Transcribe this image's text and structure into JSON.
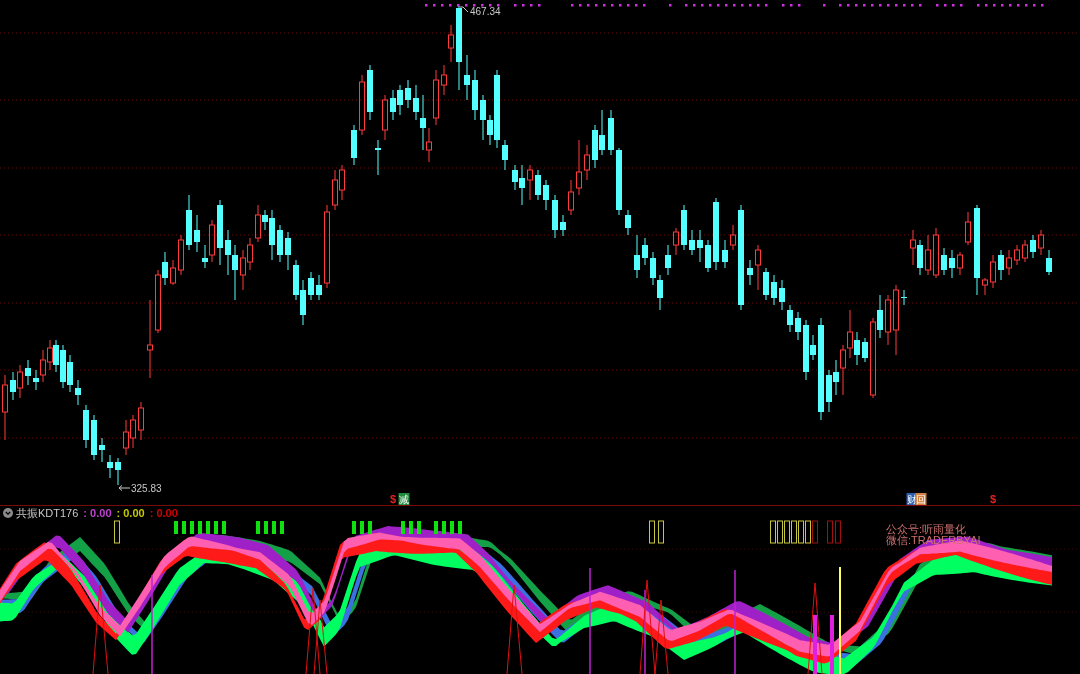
{
  "main_chart": {
    "high_label": "467.34",
    "low_label": "325.83",
    "event_markers": [
      {
        "kind": "symbol",
        "text": "$",
        "color": "#e02020"
      },
      {
        "kind": "badge",
        "text": "减",
        "color": "#1f8a3a"
      },
      {
        "kind": "badge",
        "text": "财",
        "color": "#2a5fb0"
      },
      {
        "kind": "badge",
        "text": "回",
        "color": "#d08040"
      },
      {
        "kind": "symbol",
        "text": "$",
        "color": "#e02020"
      }
    ]
  },
  "indicator": {
    "name": "共振KDT176",
    "values": [
      {
        "separator": ":",
        "text": "0.00",
        "color": "#c040d0"
      },
      {
        "separator": ":",
        "text": "0.00",
        "color": "#c8c800"
      },
      {
        "separator": ":",
        "text": "0.00",
        "color": "#d00000"
      }
    ],
    "note_lines": [
      "公众号:听雨量化",
      "微信:TRADERBYAI"
    ]
  }
}
